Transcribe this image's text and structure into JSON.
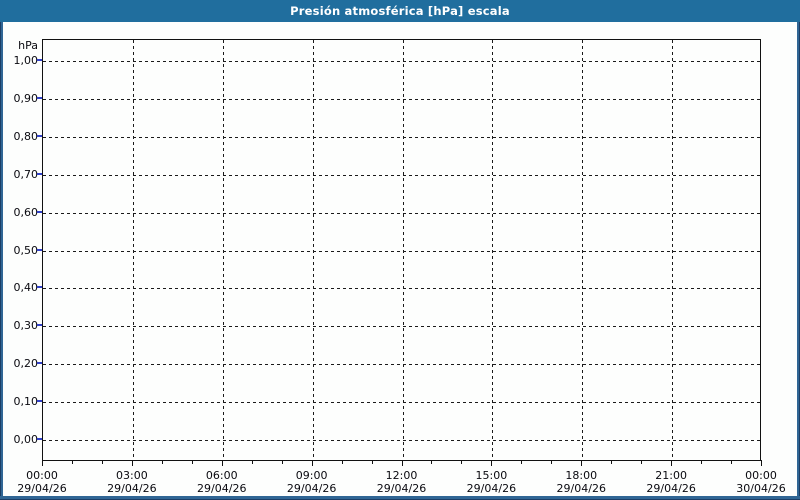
{
  "window": {
    "title": "Presión atmosférica [hPa] escala"
  },
  "colors": {
    "titlebar_bg": "#206E9E",
    "title_text": "#FFFFFF",
    "window_border_inner": "#306695",
    "window_border_outer": "#1C3E66",
    "content_bg": "#FDFEFD",
    "plot_border": "#111111",
    "gridline": "#1A1A1A",
    "y_axis_tick": "#3040C8",
    "label_text": "#0A0A10"
  },
  "chart_data": {
    "type": "line",
    "title": "Presión atmosférica [hPa] escala",
    "ylabel_unit": "hPa",
    "ylim": [
      0.0,
      1.0
    ],
    "y_tick_labels": [
      "1,00",
      "0,90",
      "0,80",
      "0,70",
      "0,60",
      "0,50",
      "0,40",
      "0,30",
      "0,20",
      "0,10",
      "0,00"
    ],
    "x_ticks": [
      {
        "time": "00:00",
        "date": "29/04/26"
      },
      {
        "time": "03:00",
        "date": "29/04/26"
      },
      {
        "time": "06:00",
        "date": "29/04/26"
      },
      {
        "time": "09:00",
        "date": "29/04/26"
      },
      {
        "time": "12:00",
        "date": "29/04/26"
      },
      {
        "time": "15:00",
        "date": "29/04/26"
      },
      {
        "time": "18:00",
        "date": "29/04/26"
      },
      {
        "time": "21:00",
        "date": "29/04/26"
      },
      {
        "time": "00:00",
        "date": "30/04/26"
      }
    ],
    "x_minor_divisions_per_interval": 3,
    "grid_style": "dashed",
    "legend": null,
    "series": []
  }
}
